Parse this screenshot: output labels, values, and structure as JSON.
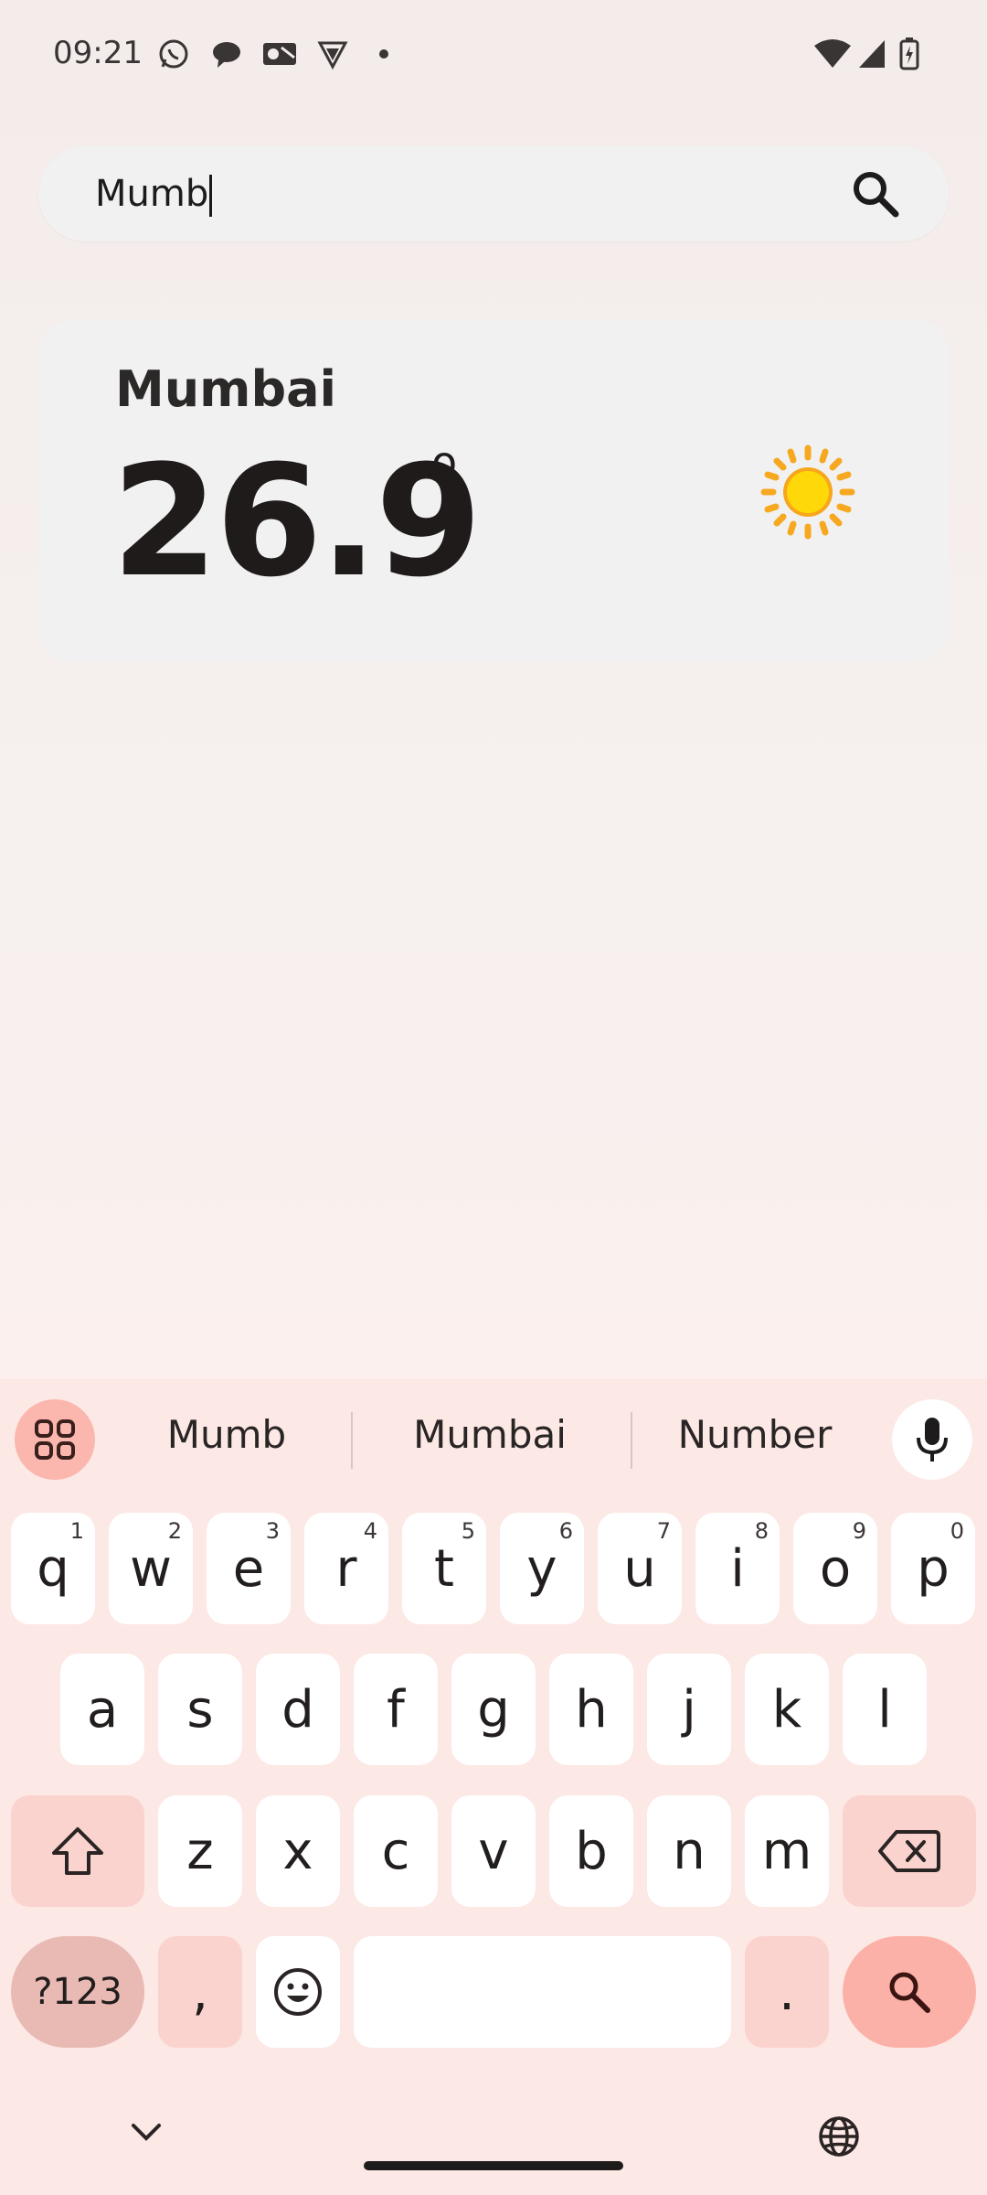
{
  "status_bar": {
    "time": "09:21",
    "notification_icons": [
      "whatsapp-icon",
      "chat-bubble-icon",
      "outlook-icon",
      "vpn-shield-icon",
      "more-dot-icon"
    ],
    "system_icons": [
      "wifi-icon",
      "signal-icon",
      "battery-charging-icon"
    ]
  },
  "search": {
    "value": "Mumb",
    "button_icon": "search-icon"
  },
  "weather": {
    "city": "Mumbai",
    "temperature": "26.9",
    "degree_symbol": "o",
    "condition_icon": "sun-icon"
  },
  "keyboard": {
    "suggestions": [
      "Mumb",
      "Mumbai",
      "Number"
    ],
    "row1": [
      {
        "letter": "q",
        "hint": "1"
      },
      {
        "letter": "w",
        "hint": "2"
      },
      {
        "letter": "e",
        "hint": "3"
      },
      {
        "letter": "r",
        "hint": "4"
      },
      {
        "letter": "t",
        "hint": "5"
      },
      {
        "letter": "y",
        "hint": "6"
      },
      {
        "letter": "u",
        "hint": "7"
      },
      {
        "letter": "i",
        "hint": "8"
      },
      {
        "letter": "o",
        "hint": "9"
      },
      {
        "letter": "p",
        "hint": "0"
      }
    ],
    "row2": [
      "a",
      "s",
      "d",
      "f",
      "g",
      "h",
      "j",
      "k",
      "l"
    ],
    "row3": [
      "z",
      "x",
      "c",
      "v",
      "b",
      "n",
      "m"
    ],
    "symbols_label": "?123",
    "comma_label": ",",
    "period_label": ".",
    "colors": {
      "accent": "#fbb1a8",
      "key": "#ffffff",
      "modifier": "#fbd3ce",
      "background": "#fce8e5"
    }
  }
}
